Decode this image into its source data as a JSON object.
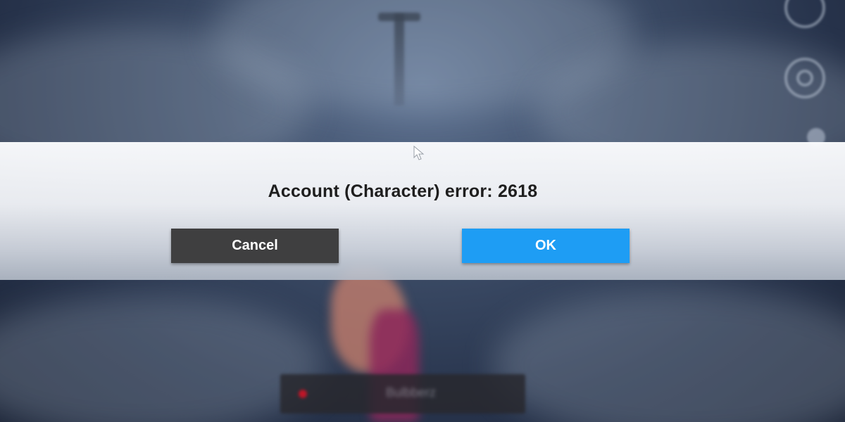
{
  "dialog": {
    "message": "Account (Character) error: 2618",
    "cancel_label": "Cancel",
    "ok_label": "OK",
    "ok_color": "#1e9df4",
    "cancel_color": "#3f3f40"
  },
  "background": {
    "bottom_bar_label": "Bulbberz"
  },
  "icons": {
    "side_top": "circle-icon",
    "side_middle": "gear-icon",
    "side_bottom": "dot-icon",
    "cursor": "mouse-pointer-icon"
  }
}
